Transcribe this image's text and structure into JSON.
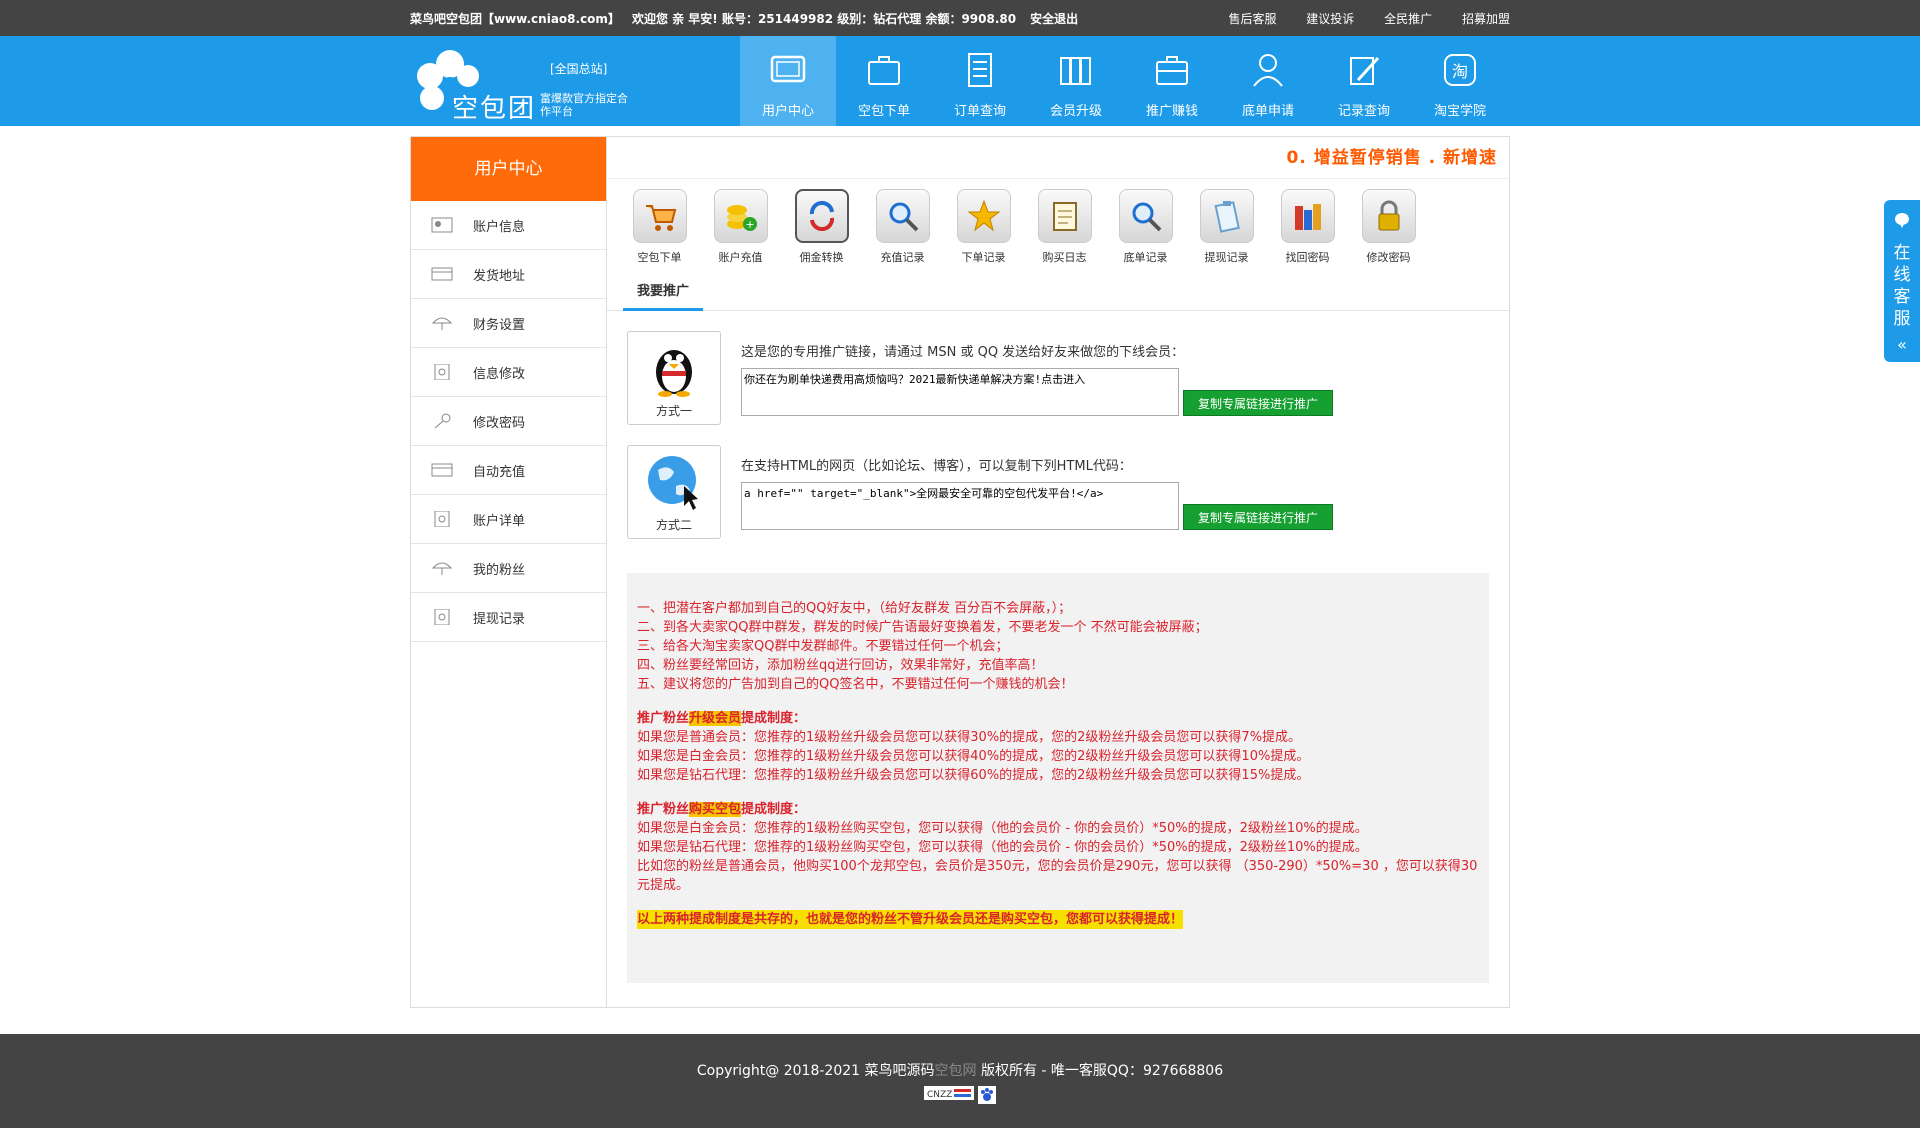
{
  "topbar": {
    "site": "菜鸟吧空包团【www.cniao8.com】",
    "welcome": "欢迎您 亲 早安! 账号：251449982 级别：钻石代理 余额：9908.80",
    "logout": "安全退出",
    "links": [
      "售后客服",
      "建议投诉",
      "全民推广",
      "招募加盟"
    ]
  },
  "logo": {
    "name": "空包团",
    "hq": "[全国总站]",
    "sub": "富爆款官方指定合作平台"
  },
  "nav": [
    {
      "label": "用户中心",
      "icon": "monitor-icon",
      "active": true
    },
    {
      "label": "空包下单",
      "icon": "briefcase-icon"
    },
    {
      "label": "订单查询",
      "icon": "document-icon"
    },
    {
      "label": "会员升级",
      "icon": "books-icon"
    },
    {
      "label": "推广赚钱",
      "icon": "briefcase-icon"
    },
    {
      "label": "底单申请",
      "icon": "users-icon"
    },
    {
      "label": "记录查询",
      "icon": "pen-icon"
    },
    {
      "label": "淘宝学院",
      "icon": "taobao-icon"
    }
  ],
  "sidebar": {
    "title": "用户中心",
    "items": [
      {
        "label": "账户信息",
        "icon": "id-card-icon"
      },
      {
        "label": "发货地址",
        "icon": "card-icon"
      },
      {
        "label": "财务设置",
        "icon": "umbrella-icon"
      },
      {
        "label": "信息修改",
        "icon": "safe-icon"
      },
      {
        "label": "修改密码",
        "icon": "key-icon"
      },
      {
        "label": "自动充值",
        "icon": "card-icon"
      },
      {
        "label": "账户详单",
        "icon": "safe-icon"
      },
      {
        "label": "我的粉丝",
        "icon": "umbrella-icon"
      },
      {
        "label": "提现记录",
        "icon": "safe-icon"
      }
    ]
  },
  "promo_text": "0. 增益暂停销售 . 新增速",
  "tools": [
    {
      "label": "空包下单",
      "icon": "cart-icon"
    },
    {
      "label": "账户充值",
      "icon": "coins-icon"
    },
    {
      "label": "佣金转换",
      "icon": "refresh-icon"
    },
    {
      "label": "充值记录",
      "icon": "search-icon"
    },
    {
      "label": "下单记录",
      "icon": "star-icon"
    },
    {
      "label": "购买日志",
      "icon": "notepad-icon"
    },
    {
      "label": "底单记录",
      "icon": "search-icon"
    },
    {
      "label": "提现记录",
      "icon": "clipboard-icon"
    },
    {
      "label": "找回密码",
      "icon": "books-icon"
    },
    {
      "label": "修改密码",
      "icon": "lock-icon"
    }
  ],
  "tab": "我要推广",
  "method1": {
    "label": "方式一",
    "icon": "qq-penguin-icon",
    "desc": "这是您的专用推广链接，请通过 MSN 或 QQ 发送给好友来做您的下线会员：",
    "text": "你还在为刷单快递费用高烦恼吗？2021最新快递单解决方案!点击进入",
    "button": "复制专属链接进行推广"
  },
  "method2": {
    "label": "方式二",
    "icon": "globe-icon",
    "desc": "在支持HTML的网页（比如论坛、博客），可以复制下列HTML代码：",
    "text": "a href=\"\" target=\"_blank\">全网最安全可靠的空包代发平台!</a>",
    "button": "复制专属链接进行推广"
  },
  "notes": {
    "list": [
      "一、把潜在客户都加到自己的QQ好友中，（给好友群发 百分百不会屏蔽，）；",
      "二、到各大卖家QQ群中群发，群发的时候广告语最好变换着发，不要老发一个 不然可能会被屏蔽；",
      "三、给各大淘宝卖家QQ群中发群邮件。不要错过任何一个机会；",
      "四、粉丝要经常回访，添加粉丝qq进行回访，效果非常好，充值率高！",
      "五、建议将您的广告加到自己的QQ签名中，不要错过任何一个赚钱的机会！"
    ],
    "h1_pre": "推广粉丝",
    "h1_hl": "升级会员",
    "h1_post": "提成制度：",
    "upgrade": [
      "如果您是普通会员：您推荐的1级粉丝升级会员您可以获得30%的提成，您的2级粉丝升级会员您可以获得7%提成。",
      "如果您是白金会员：您推荐的1级粉丝升级会员您可以获得40%的提成，您的2级粉丝升级会员您可以获得10%提成。",
      "如果您是钻石代理：您推荐的1级粉丝升级会员您可以获得60%的提成，您的2级粉丝升级会员您可以获得15%提成。"
    ],
    "h2_pre": "推广粉丝",
    "h2_hl": "购买空包",
    "h2_post": "提成制度：",
    "buy": [
      "如果您是白金会员：您推荐的1级粉丝购买空包，您可以获得（他的会员价 - 你的会员价）*50%的提成，2级粉丝10%的提成。",
      "如果您是钻石代理：您推荐的1级粉丝购买空包，您可以获得（他的会员价 - 你的会员价）*50%的提成，2级粉丝10%的提成。",
      "比如您的粉丝是普通会员，他购买100个龙邦空包，会员价是350元，您的会员价是290元，您可以获得 （350-290）*50%=30 ，您可以获得30元提成。"
    ],
    "final": "以上两种提成制度是共存的，也就是您的粉丝不管升级会员还是购买空包，您都可以获得提成！"
  },
  "footer": {
    "pre": "Copyright@ 2018-2021 菜鸟吧源码",
    "brand": "空包网",
    "post": " 版权所有 - 唯一客服QQ：927668806",
    "badge": "CNZZ"
  },
  "kefu": "在线客服",
  "colors": {
    "accent": "#1e9be8",
    "orange": "#ff6b0a",
    "green": "#16a032",
    "red": "#d9232d"
  }
}
